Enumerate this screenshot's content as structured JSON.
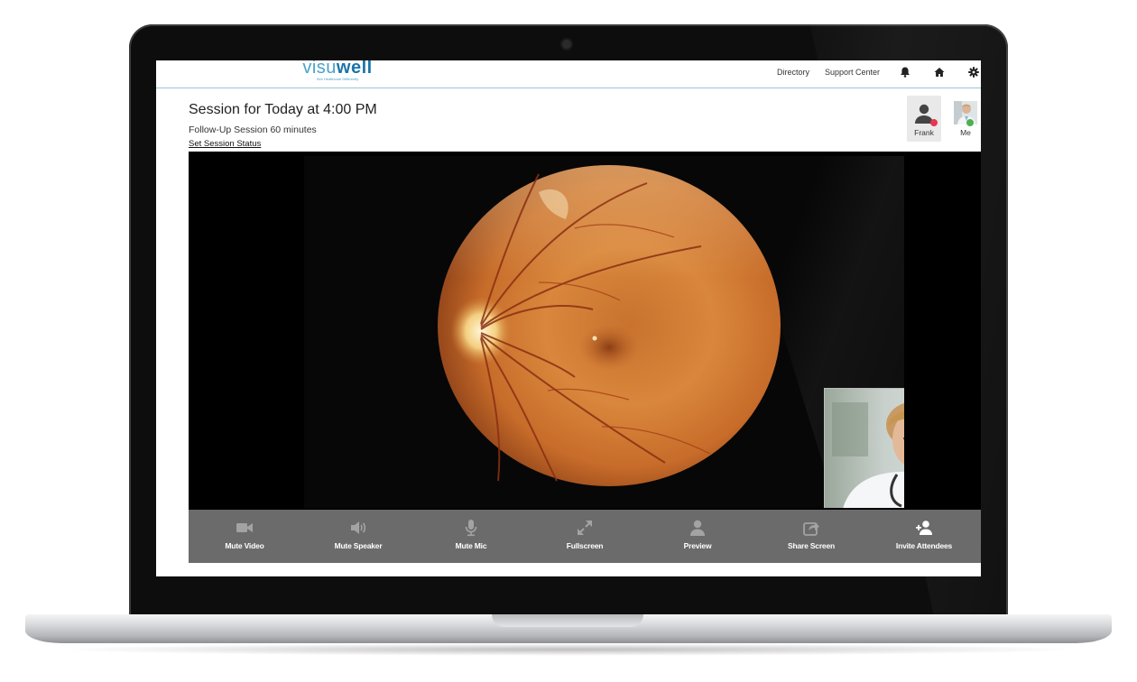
{
  "brand": {
    "name_part1": "visu",
    "name_part2": "well",
    "tagline": "See Healthcare Differently"
  },
  "nav": {
    "directory": "Directory",
    "support_center": "Support Center",
    "icons": [
      "bell-icon",
      "home-icon",
      "gear-icon"
    ]
  },
  "session": {
    "title": "Session for Today at 4:00 PM",
    "subtitle": "Follow-Up Session 60 minutes",
    "status_link": "Set Session Status"
  },
  "attendees": [
    {
      "name": "Frank",
      "status": "offline",
      "status_color": "#e8344e",
      "icon": "user-silhouette-icon"
    },
    {
      "name": "Me",
      "status": "online",
      "status_color": "#4cb050",
      "icon": "user-photo-icon"
    }
  ],
  "video": {
    "main_feed": "retina-fundus-image",
    "pip_feed": "doctor-camera-feed"
  },
  "controls": [
    {
      "label": "Mute Video",
      "icon": "video-camera-icon"
    },
    {
      "label": "Mute Speaker",
      "icon": "speaker-icon"
    },
    {
      "label": "Mute Mic",
      "icon": "microphone-icon"
    },
    {
      "label": "Fullscreen",
      "icon": "expand-icon"
    },
    {
      "label": "Preview",
      "icon": "person-icon"
    },
    {
      "label": "Share Screen",
      "icon": "share-icon"
    },
    {
      "label": "Invite Attendees",
      "icon": "add-user-icon"
    }
  ],
  "colors": {
    "brand_light": "#4aa3c8",
    "brand_dark": "#1b75a8",
    "control_bar": "#6b6b6b",
    "control_icon": "#a3a3a3"
  }
}
